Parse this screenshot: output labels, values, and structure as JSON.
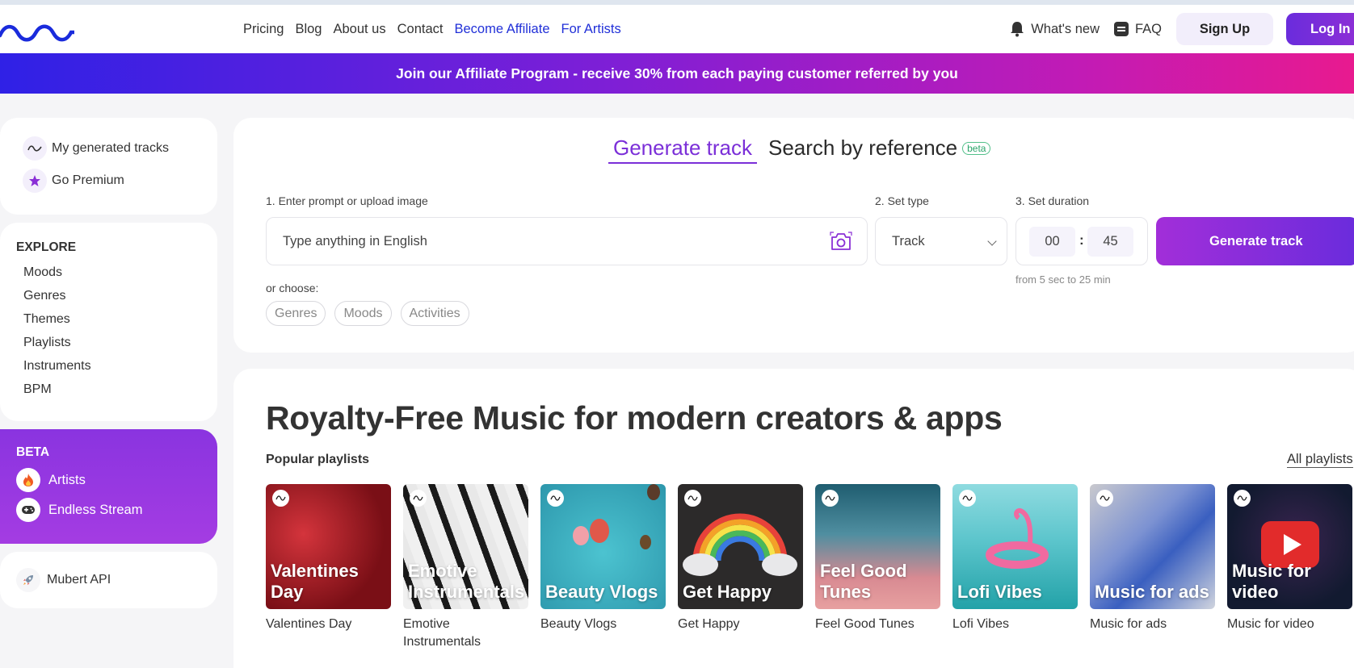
{
  "nav": {
    "links": [
      "Pricing",
      "Blog",
      "About us",
      "Contact",
      "Become Affiliate",
      "For Artists"
    ],
    "whats_new": "What's new",
    "faq": "FAQ",
    "signup": "Sign Up",
    "login": "Log In",
    "brand_color": "#1a2bdc"
  },
  "banner": {
    "text": "Join our Affiliate Program - receive 30% from each paying customer referred by you"
  },
  "sidebar": {
    "top_items": [
      {
        "label": "My generated tracks",
        "icon": "wave-icon"
      },
      {
        "label": "Go Premium",
        "icon": "star-icon"
      }
    ],
    "explore_title": "EXPLORE",
    "explore_items": [
      "Moods",
      "Genres",
      "Themes",
      "Playlists",
      "Instruments",
      "BPM"
    ],
    "beta_title": "BETA",
    "beta_items": [
      {
        "label": "Artists",
        "icon": "fire-icon"
      },
      {
        "label": "Endless Stream",
        "icon": "gamepad-icon"
      }
    ],
    "api_label": "Mubert API"
  },
  "generator": {
    "tab_active": "Generate track",
    "tab_other": "Search by reference",
    "beta_badge": "beta",
    "step1_label": "1. Enter prompt or upload image",
    "prompt_placeholder": "Type anything in English",
    "step2_label": "2. Set type",
    "type_value": "Track",
    "step3_label": "3. Set duration",
    "minutes": "00",
    "seconds": "45",
    "duration_hint": "from 5 sec to 25 min",
    "button": "Generate track",
    "or_choose": "or choose:",
    "chips": [
      "Genres",
      "Moods",
      "Activities"
    ]
  },
  "main": {
    "heading": "Royalty-Free Music for modern creators & apps",
    "popular_label": "Popular playlists",
    "all_playlists": "All playlists",
    "playlists": [
      {
        "overlay": "Valentines Day",
        "caption": "Valentines Day",
        "bg": "#9a1a22"
      },
      {
        "overlay": "Emotive Instrumentals",
        "caption": "Emotive Instrumentals",
        "bg": "#444444"
      },
      {
        "overlay": "Beauty Vlogs",
        "caption": "Beauty Vlogs",
        "bg": "#37a9bd"
      },
      {
        "overlay": "Get Happy",
        "caption": "Get Happy",
        "bg": "#2a2a2a"
      },
      {
        "overlay": "Feel Good Tunes",
        "caption": "Feel Good Tunes",
        "bg": "#3a6d80"
      },
      {
        "overlay": "Lofi Vibes",
        "caption": "Lofi Vibes",
        "bg": "#3cc0c0"
      },
      {
        "overlay": "Music for ads",
        "caption": "Music for ads",
        "bg": "#8fa2d6"
      },
      {
        "overlay": "Music for video",
        "caption": "Music for video",
        "bg": "#1c2340"
      }
    ]
  }
}
